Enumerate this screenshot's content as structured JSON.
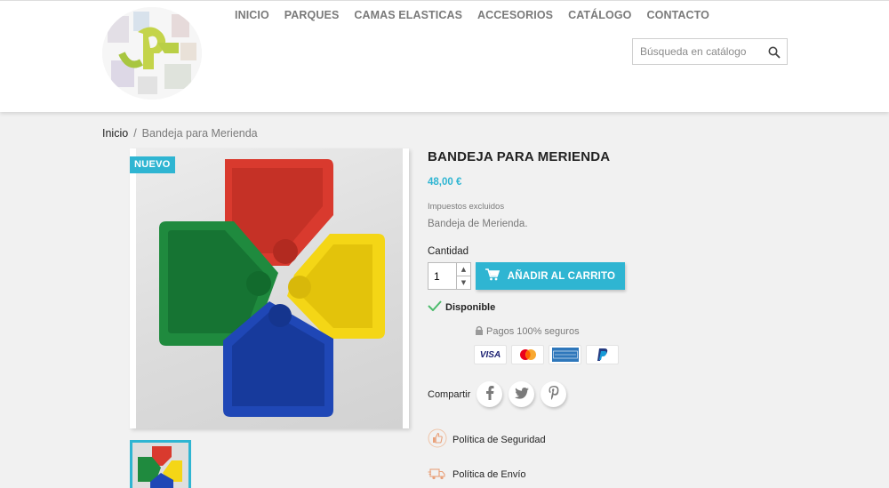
{
  "header": {
    "nav": [
      "INICIO",
      "PARQUES",
      "CAMAS ELASTICAS",
      "ACCESORIOS",
      "CATÁLOGO",
      "CONTACTO"
    ],
    "search_placeholder": "Búsqueda en catálogo"
  },
  "breadcrumb": {
    "home": "Inicio",
    "current": "Bandeja para Merienda"
  },
  "product": {
    "badge": "NUEVO",
    "title": "BANDEJA PARA MERIENDA",
    "price": "48,00 €",
    "tax_note": "Impuestos excluidos",
    "description": "Bandeja de Merienda.",
    "quantity_label": "Cantidad",
    "quantity_value": "1",
    "add_to_cart": "AÑADIR AL CARRITO",
    "availability": "Disponible",
    "secure_payments": "Pagos 100% seguros",
    "payment_cards": [
      "VISA",
      "mastercard",
      "AMERICAN EXPRESS",
      "PayPal"
    ],
    "share_label": "Compartir",
    "reassurance": [
      "Política de Seguridad",
      "Política de Envío"
    ]
  },
  "colors": {
    "accent": "#2fb5d2",
    "available": "#4cbb6c"
  }
}
